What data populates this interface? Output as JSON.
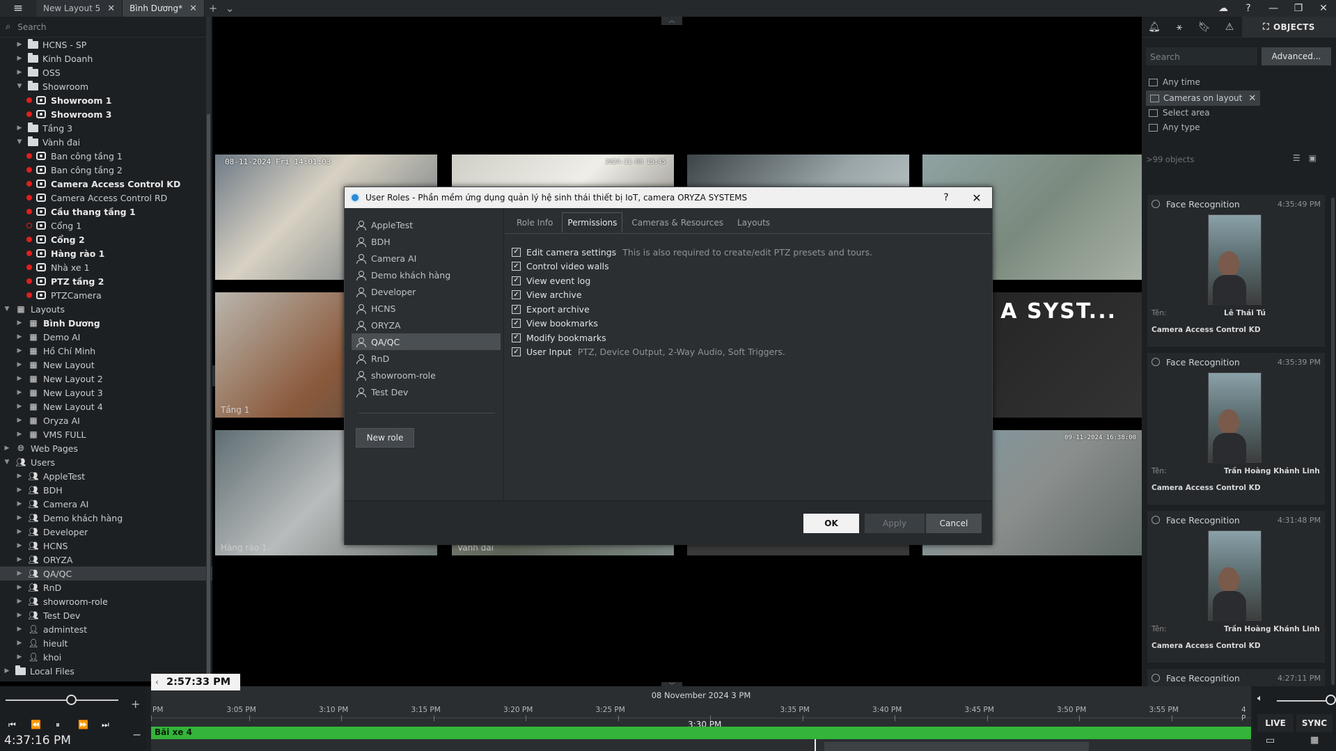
{
  "tabs": [
    {
      "label": "New Layout 5"
    },
    {
      "label": "Bình Dương*"
    }
  ],
  "left": {
    "search_placeholder": "Search",
    "tree": [
      {
        "label": "HCNS - SP",
        "type": "folder",
        "depth": 1
      },
      {
        "label": "Kinh Doanh",
        "type": "folder",
        "depth": 1
      },
      {
        "label": "OSS",
        "type": "folder",
        "depth": 1
      },
      {
        "label": "Showroom",
        "type": "folder",
        "depth": 1,
        "open": true
      },
      {
        "label": "Showroom 1",
        "type": "camera",
        "depth": 2,
        "bold": true
      },
      {
        "label": "Showroom 3",
        "type": "camera",
        "depth": 2,
        "bold": true
      },
      {
        "label": "Tầng 3",
        "type": "folder",
        "depth": 1
      },
      {
        "label": "Vành đai",
        "type": "folder",
        "depth": 1,
        "open": true
      },
      {
        "label": "Ban công tầng 1",
        "type": "camera",
        "depth": 2
      },
      {
        "label": "Ban công tầng 2",
        "type": "camera",
        "depth": 2
      },
      {
        "label": "Camera Access Control KD",
        "type": "camera",
        "depth": 2,
        "bold": true
      },
      {
        "label": "Camera Access Control RD",
        "type": "camera",
        "depth": 2
      },
      {
        "label": "Cầu thang tầng 1",
        "type": "camera",
        "depth": 2,
        "bold": true
      },
      {
        "label": "Cổng 1",
        "type": "camera-off",
        "depth": 2
      },
      {
        "label": "Cổng 2",
        "type": "camera",
        "depth": 2,
        "bold": true
      },
      {
        "label": "Hàng rào 1",
        "type": "camera",
        "depth": 2,
        "bold": true
      },
      {
        "label": "Nhà xe 1",
        "type": "camera",
        "depth": 2
      },
      {
        "label": "PTZ tầng 2",
        "type": "camera",
        "depth": 2,
        "bold": true
      },
      {
        "label": "PTZCamera",
        "type": "camera",
        "depth": 2
      },
      {
        "label": "Layouts",
        "type": "root-layouts",
        "depth": 0,
        "open": true
      },
      {
        "label": "Bình Dương",
        "type": "layout",
        "depth": 1,
        "bold": true
      },
      {
        "label": "Demo AI",
        "type": "layout",
        "depth": 1
      },
      {
        "label": "Hồ Chí Minh",
        "type": "layout",
        "depth": 1
      },
      {
        "label": "New Layout",
        "type": "layout",
        "depth": 1
      },
      {
        "label": "New Layout 2",
        "type": "layout",
        "depth": 1
      },
      {
        "label": "New Layout 3",
        "type": "layout",
        "depth": 1
      },
      {
        "label": "New Layout 4",
        "type": "layout",
        "depth": 1
      },
      {
        "label": "Oryza AI",
        "type": "layout",
        "depth": 1
      },
      {
        "label": "VMS FULL",
        "type": "layout",
        "depth": 1
      },
      {
        "label": "Web Pages",
        "type": "root-web",
        "depth": 0
      },
      {
        "label": "Users",
        "type": "root-users",
        "depth": 0,
        "open": true
      },
      {
        "label": "AppleTest",
        "type": "group",
        "depth": 1
      },
      {
        "label": "BDH",
        "type": "group",
        "depth": 1
      },
      {
        "label": "Camera AI",
        "type": "group",
        "depth": 1
      },
      {
        "label": "Demo khách hàng",
        "type": "group",
        "depth": 1
      },
      {
        "label": "Developer",
        "type": "group",
        "depth": 1
      },
      {
        "label": "HCNS",
        "type": "group",
        "depth": 1
      },
      {
        "label": "ORYZA",
        "type": "group",
        "depth": 1
      },
      {
        "label": "QA/QC",
        "type": "group",
        "depth": 1,
        "selected": true
      },
      {
        "label": "RnD",
        "type": "group",
        "depth": 1
      },
      {
        "label": "showroom-role",
        "type": "group",
        "depth": 1
      },
      {
        "label": "Test Dev",
        "type": "group",
        "depth": 1
      },
      {
        "label": "admintest",
        "type": "user",
        "depth": 1
      },
      {
        "label": "hieult",
        "type": "user",
        "depth": 1
      },
      {
        "label": "khoi",
        "type": "user",
        "depth": 1
      },
      {
        "label": "Local Files",
        "type": "root-files",
        "depth": 0
      }
    ]
  },
  "grid": {
    "cells": [
      {
        "ts": "08-11-2024 Fri 14:01:03",
        "ts2": "",
        "name": "",
        "tone": "linear-gradient(135deg,#6d7a86 0%,#d9d2c4 40%,#5f6b72 100%)"
      },
      {
        "ts": "",
        "ts2": "2024-11-08 15:45",
        "name": "",
        "tone": "linear-gradient(135deg,#cfcfc8 0%,#efefe8 45%,#6f6a63 100%)"
      },
      {
        "ts": "",
        "ts2": "",
        "name": "",
        "tone": "linear-gradient(135deg,#3d4448 0%,#9aa6a9 50%,#cdd3d2 100%)"
      },
      {
        "ts": "",
        "ts2": "",
        "name": "",
        "tone": "linear-gradient(135deg,#8fa3a3 0%,#7b8a7e 50%,#a9b2a6 100%)"
      },
      {
        "ts": "",
        "ts2": "",
        "name": "",
        "tone": "linear-gradient(135deg,#b9b6ae 0%,#8b5a3c 55%,#4f4b46 100%)"
      },
      {
        "ts": "",
        "ts2": "",
        "name": "",
        "tone": "linear-gradient(135deg,#222 0%,#333 100%)",
        "watermark": "A SYST..."
      },
      {
        "ts": "",
        "ts2": "",
        "name": "",
        "tone": "linear-gradient(135deg,#5f6e73 0%,#b9bcbc 50%,#6a7370 100%)"
      },
      {
        "ts": "",
        "ts2": "",
        "name": "",
        "tone": "linear-gradient(135deg,#9a9d94 0%,#5c6358 50%,#7c8782 100%)"
      },
      {
        "ts": "",
        "ts2": "09-11-2024 16:38:00",
        "name": "",
        "tone": "linear-gradient(135deg,#7f9aa4 0%,#8a8e8c 50%,#5f6966 100%)"
      }
    ],
    "cell_names": [
      "Tầng 1",
      "Hàng rào 1",
      "Vành đai"
    ]
  },
  "dialog": {
    "title": "User Roles - Phần mềm ứng dụng quản lý hệ sinh thái thiết bị IoT, camera ORYZA SYSTEMS",
    "roles": [
      "AppleTest",
      "BDH",
      "Camera AI",
      "Demo khách hàng",
      "Developer",
      "HCNS",
      "ORYZA",
      "QA/QC",
      "RnD",
      "showroom-role",
      "Test Dev"
    ],
    "selected_role_index": 7,
    "new_role_label": "New role",
    "tabs": [
      "Role Info",
      "Permissions",
      "Cameras & Resources",
      "Layouts"
    ],
    "active_tab_index": 1,
    "permissions": [
      {
        "label": "Edit camera settings",
        "hint": "This is also required to create/edit PTZ presets and tours.",
        "checked": true
      },
      {
        "label": "Control video walls",
        "hint": "",
        "checked": true
      },
      {
        "label": "View event log",
        "hint": "",
        "checked": true
      },
      {
        "label": "View archive",
        "hint": "",
        "checked": true
      },
      {
        "label": "Export archive",
        "hint": "",
        "checked": true
      },
      {
        "label": "View bookmarks",
        "hint": "",
        "checked": true
      },
      {
        "label": "Modify bookmarks",
        "hint": "",
        "checked": true
      },
      {
        "label": "User Input",
        "hint": "PTZ, Device Output, 2-Way Audio, Soft Triggers.",
        "checked": true
      }
    ],
    "ok_label": "OK",
    "apply_label": "Apply",
    "cancel_label": "Cancel",
    "help_label": "?",
    "close_label": "✕"
  },
  "right": {
    "objects_label": "OBJECTS",
    "search_placeholder": "Search",
    "advanced_label": "Advanced...",
    "filters": {
      "any_time": "Any time",
      "chip": "Cameras on layout",
      "select_area": "Select area",
      "any_type": "Any type"
    },
    "count": ">99 objects",
    "events": [
      {
        "type": "Face Recognition",
        "time": "4:35:49 PM",
        "key": "Tên:",
        "value": "Lê Thái Tú",
        "camera": "Camera Access Control KD"
      },
      {
        "type": "Face Recognition",
        "time": "4:35:39 PM",
        "key": "Tên:",
        "value": "Trần Hoàng Khánh Linh",
        "camera": "Camera Access Control KD"
      },
      {
        "type": "Face Recognition",
        "time": "4:31:48 PM",
        "key": "Tên:",
        "value": "Trần Hoàng Khánh Linh",
        "camera": "Camera Access Control KD"
      },
      {
        "type": "Face Recognition",
        "time": "4:27:11 PM",
        "key": "",
        "value": "",
        "camera": ""
      }
    ]
  },
  "timeline": {
    "current_time": "4:37:16 PM",
    "chip_time": "2:57:33 PM",
    "date_label": "08 November 2024 3 PM",
    "ticks": [
      {
        "label": "PM",
        "big": false
      },
      {
        "label": "3:05 PM",
        "big": false
      },
      {
        "label": "3:10 PM",
        "big": false
      },
      {
        "label": "3:15 PM",
        "big": false
      },
      {
        "label": "3:20 PM",
        "big": false
      },
      {
        "label": "3:25 PM",
        "big": false
      },
      {
        "label": "3:30 PM",
        "big": true
      },
      {
        "label": "3:35 PM",
        "big": false
      },
      {
        "label": "3:40 PM",
        "big": false
      },
      {
        "label": "3:45 PM",
        "big": false
      },
      {
        "label": "3:50 PM",
        "big": false
      },
      {
        "label": "3:55 PM",
        "big": false
      },
      {
        "label": "4 P",
        "big": false
      }
    ],
    "track_label": "Bãi xe 4",
    "live_label": "LIVE",
    "sync_label": "SYNC"
  }
}
